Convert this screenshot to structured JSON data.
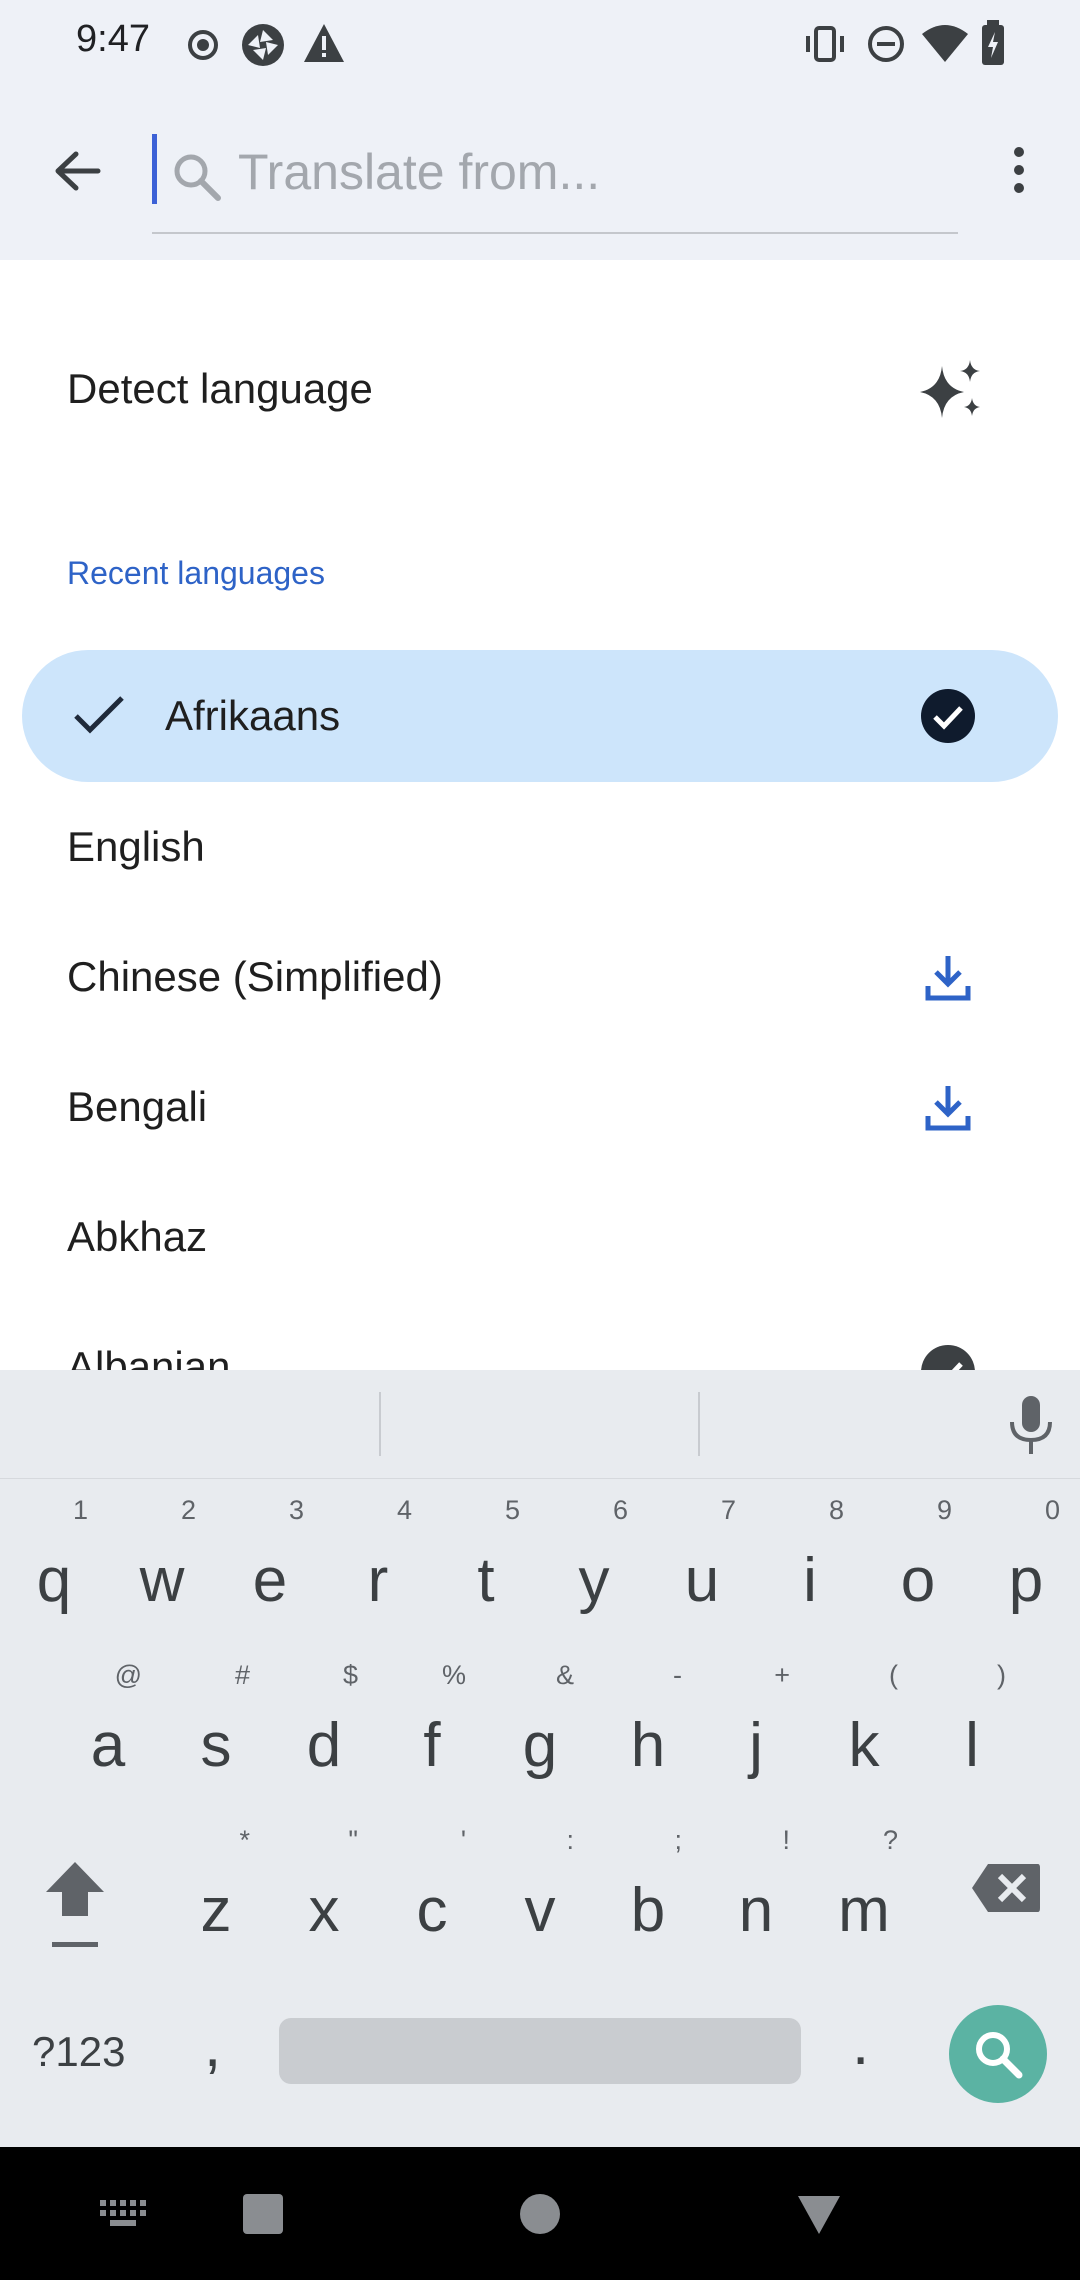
{
  "status_bar": {
    "time": "9:47"
  },
  "search": {
    "placeholder": "Translate from..."
  },
  "detect": {
    "label": "Detect language"
  },
  "recent": {
    "header": "Recent languages",
    "items": [
      {
        "label": "Afrikaans"
      },
      {
        "label": "English"
      },
      {
        "label": "Chinese (Simplified)"
      },
      {
        "label": "Bengali"
      },
      {
        "label": "Abkhaz"
      },
      {
        "label": "Albanian"
      }
    ]
  },
  "keyboard": {
    "row1": [
      {
        "k": "q",
        "h": "1"
      },
      {
        "k": "w",
        "h": "2"
      },
      {
        "k": "e",
        "h": "3"
      },
      {
        "k": "r",
        "h": "4"
      },
      {
        "k": "t",
        "h": "5"
      },
      {
        "k": "y",
        "h": "6"
      },
      {
        "k": "u",
        "h": "7"
      },
      {
        "k": "i",
        "h": "8"
      },
      {
        "k": "o",
        "h": "9"
      },
      {
        "k": "p",
        "h": "0"
      }
    ],
    "row2": [
      {
        "k": "a",
        "h": "@"
      },
      {
        "k": "s",
        "h": "#"
      },
      {
        "k": "d",
        "h": "$"
      },
      {
        "k": "f",
        "h": "%"
      },
      {
        "k": "g",
        "h": "&"
      },
      {
        "k": "h",
        "h": "-"
      },
      {
        "k": "j",
        "h": "+"
      },
      {
        "k": "k",
        "h": "("
      },
      {
        "k": "l",
        "h": ")"
      }
    ],
    "row3": [
      {
        "k": "z",
        "h": "*"
      },
      {
        "k": "x",
        "h": "\""
      },
      {
        "k": "c",
        "h": "'"
      },
      {
        "k": "v",
        "h": ":"
      },
      {
        "k": "b",
        "h": ";"
      },
      {
        "k": "n",
        "h": "!"
      },
      {
        "k": "m",
        "h": "?"
      }
    ],
    "symbols_label": "?123",
    "comma": ",",
    "period": "."
  },
  "colors": {
    "accent": "#2e63c7",
    "selected_bg": "#cde5fb",
    "search_fab": "#5bb3a3"
  }
}
